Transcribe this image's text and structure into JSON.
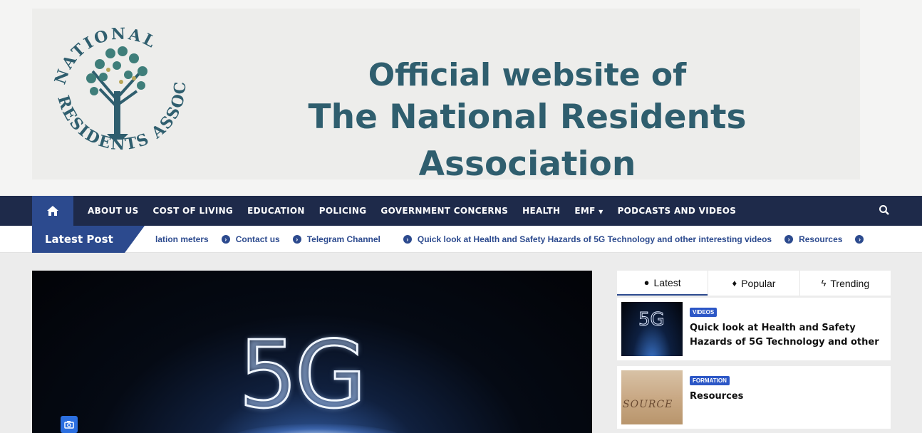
{
  "banner": {
    "logo_text": "NATIONAL RESIDENTS ASSOCIATION",
    "title_line1": "Official website of",
    "title_line2": "The National Residents Association"
  },
  "nav": {
    "items": [
      "ABOUT US",
      "COST OF LIVING",
      "EDUCATION",
      "POLICING",
      "GOVERNMENT CONCERNS",
      "HEALTH",
      "EMF",
      "PODCASTS AND VIDEOS"
    ],
    "icons": {
      "home": "home-icon",
      "search": "search-icon",
      "dropdown": "chevron-down-icon"
    }
  },
  "ticker": {
    "label": "Latest Post",
    "items": [
      "lation meters",
      "Contact us",
      "Telegram Channel",
      "Quick look at Health and Safety Hazards of 5G Technology and other interesting videos",
      "Resources"
    ]
  },
  "hero": {
    "image_text": "5G",
    "icon": "camera-icon"
  },
  "sidebar": {
    "tabs": [
      {
        "label": "Latest",
        "icon": "clock-icon"
      },
      {
        "label": "Popular",
        "icon": "fire-icon"
      },
      {
        "label": "Trending",
        "icon": "bolt-icon"
      }
    ],
    "posts": [
      {
        "category": "VIDEOS",
        "title": "Quick look at Health and Safety Hazards of 5G Technology and other",
        "thumb_text": "5G"
      },
      {
        "category": "FORMATION",
        "title": "Resources",
        "thumb_text": "SOURCE"
      }
    ]
  },
  "colors": {
    "nav_bg": "#1e2a4a",
    "accent": "#2c4a8e",
    "title": "#2f5e6e",
    "badge": "#2c57c6"
  }
}
